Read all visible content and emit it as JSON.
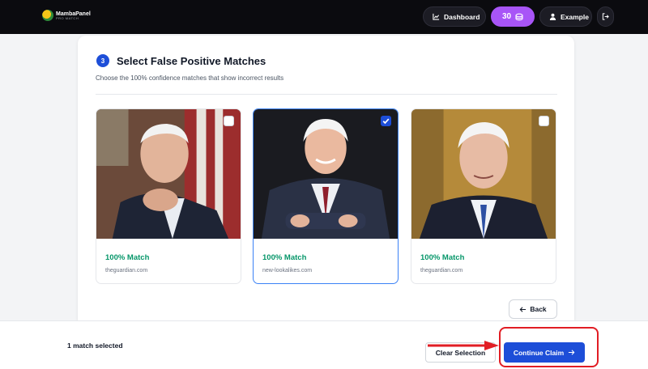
{
  "header": {
    "logo_name": "MambaPanel",
    "logo_tag": "PRO MATCH",
    "dashboard_label": "Dashboard",
    "credits": "30",
    "user_label": "Example"
  },
  "step": {
    "number": "3",
    "title": "Select False Positive Matches",
    "subtitle": "Choose the 100% confidence matches that show incorrect results"
  },
  "matches": [
    {
      "label": "100% Match",
      "source": "theguardian.com",
      "selected": false
    },
    {
      "label": "100% Match",
      "source": "new-lookalikes.com",
      "selected": true
    },
    {
      "label": "100% Match",
      "source": "theguardian.com",
      "selected": false
    }
  ],
  "back_label": "Back",
  "footer": {
    "selected_text": "1 match selected",
    "clear_label": "Clear Selection",
    "continue_label": "Continue Claim"
  },
  "colors": {
    "accent": "#1d4ed8",
    "credits_bg": "#a855f7",
    "match_green": "#059669",
    "annotation_red": "#e11d24"
  }
}
